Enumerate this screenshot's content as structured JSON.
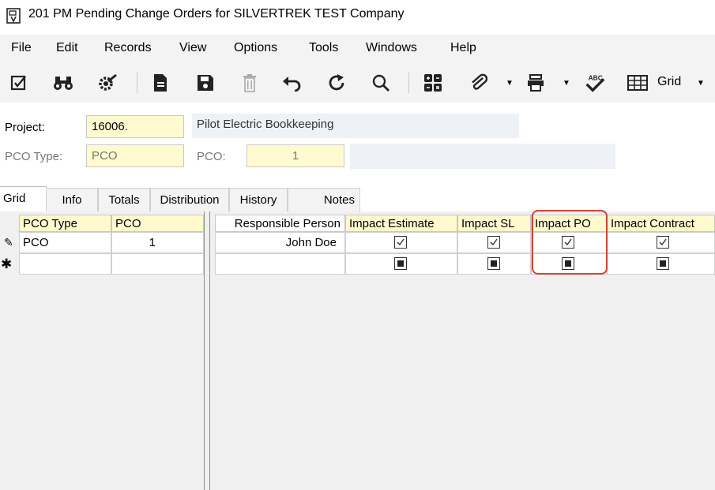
{
  "window": {
    "title": "201 PM Pending Change Orders for SILVERTREK TEST Company"
  },
  "menu": [
    "File",
    "Edit",
    "Records",
    "View",
    "Options",
    "Tools",
    "Windows",
    "Help"
  ],
  "toolbar": {
    "grid_label": "Grid"
  },
  "form": {
    "project_label": "Project:",
    "project_value": "16006.",
    "project_desc": "Pilot Electric Bookkeeping",
    "pco_type_label": "PCO Type:",
    "pco_type_value": "PCO",
    "pco_label": "PCO:",
    "pco_value": "1"
  },
  "tabs": [
    "Grid",
    "Info",
    "Totals",
    "Distribution",
    "History",
    "Notes"
  ],
  "grid": {
    "left_headers": [
      "PCO Type",
      "PCO"
    ],
    "right_headers": [
      "Responsible Person",
      "Impact Estimate",
      "Impact SL",
      "Impact PO",
      "Impact Contract"
    ],
    "rows": [
      {
        "pco_type": "PCO",
        "pco": "1",
        "responsible": "John Doe",
        "impact_estimate": true,
        "impact_sl": true,
        "impact_po": true,
        "impact_contract": true
      }
    ]
  },
  "colors": {
    "highlight": "#d04433",
    "field_yellow": "#fffad0",
    "header_yellow": "#fff9cc"
  }
}
